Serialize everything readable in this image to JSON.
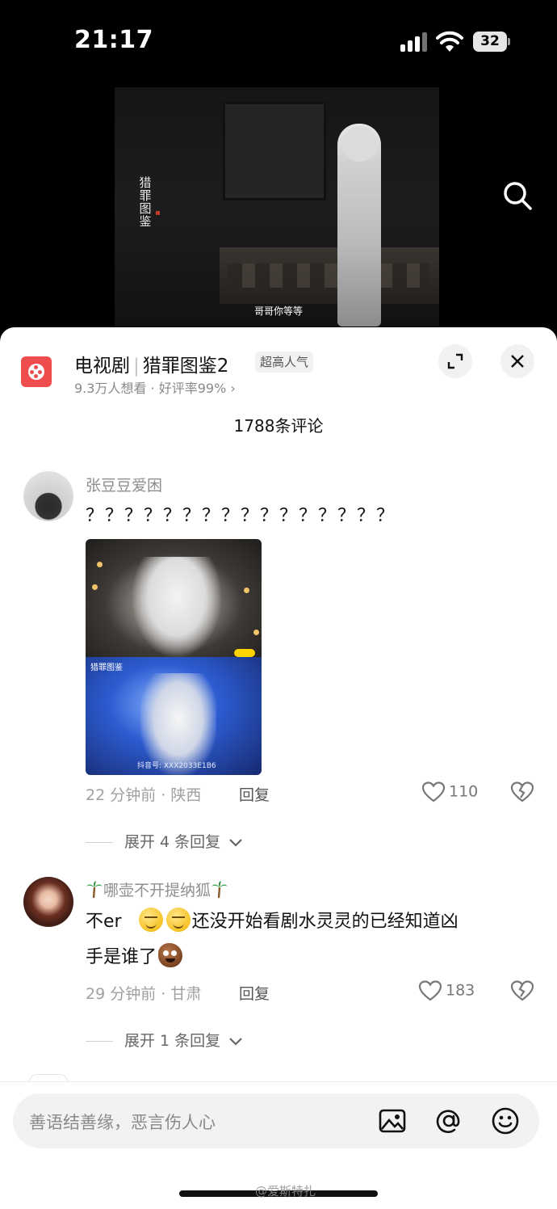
{
  "status_bar": {
    "time": "21:17",
    "battery": "32"
  },
  "video": {
    "logo_text": "猎罪图鉴",
    "subtitle": "哥哥你等等"
  },
  "show": {
    "category": "电视剧",
    "title": "猎罪图鉴2",
    "badge": "超高人气",
    "meta": "9.3万人想看 · 好评率99% ›"
  },
  "comment_count": "1788条评论",
  "comments": [
    {
      "username": "张豆豆爱困",
      "text": "？？？？？？？？？？？？？？？？",
      "image_watermark": "抖音号: XXX2033E1B6",
      "image_logo": "猎罪图鉴",
      "time_location": "22 分钟前 · 陕西",
      "reply_label": "回复",
      "likes": "110",
      "expand_label": "展开 4 条回复"
    },
    {
      "username": "哪壶不开提纳狐",
      "text_part1": "不er",
      "text_part2": "还没开始看剧水灵灵的已经知道凶",
      "text_part3": "手是谁了",
      "time_location": "29 分钟前 · 甘肃",
      "reply_label": "回复",
      "likes": "183",
      "expand_label": "展开 1 条回复"
    }
  ],
  "input": {
    "placeholder": "善语结善缘，恶言伤人心"
  },
  "watermark": "@爱斯特扎"
}
